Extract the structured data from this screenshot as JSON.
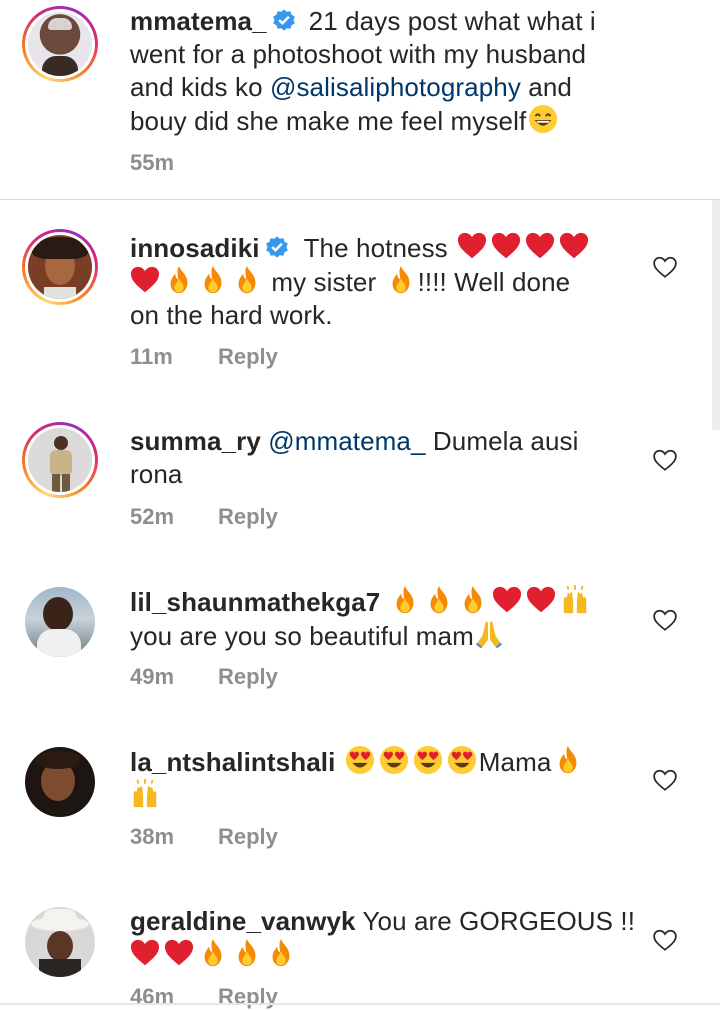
{
  "caption": {
    "username": "mmatema_",
    "text_1": "21 days post what what i",
    "text_2": "went for a photoshoot with my husband",
    "text_3a": "and kids ko ",
    "mention": "@salisaliphotography",
    "text_3b": " and",
    "text_4": "bouy did she make me feel myself",
    "time": "55m"
  },
  "comments": [
    {
      "username": "innosadiki",
      "line1": "The hotness",
      "line2a": "my sister",
      "line2b": "!!!! Well done",
      "line3": "on the hard work.",
      "time": "11m",
      "reply": "Reply"
    },
    {
      "username": "summa_ry",
      "mention": "@mmatema_",
      "line1": " Dumela ausi",
      "line2": "rona",
      "time": "52m",
      "reply": "Reply"
    },
    {
      "username": "lil_shaunmathekga7",
      "line2": "you are you so beautiful mam",
      "time": "49m",
      "reply": "Reply"
    },
    {
      "username": "la_ntshalintshali",
      "line1": "Mama",
      "time": "38m",
      "reply": "Reply"
    },
    {
      "username": "geraldine_vanwyk",
      "line1": "You are GORGEOUS !!",
      "time": "46m",
      "reply": "Reply"
    }
  ],
  "colors": {
    "text": "#262626",
    "mention": "#00376b",
    "meta": "#8e8e8e",
    "verified": "#3897f0",
    "heart_emoji": "#e0202e",
    "fire_emoji": "#f58a07"
  },
  "icons": [
    "verified-badge-icon",
    "heart-outline-icon",
    "red-heart-emoji",
    "fire-emoji",
    "grinning-emoji",
    "heart-eyes-emoji",
    "raising-hands-emoji",
    "praying-hands-emoji"
  ]
}
